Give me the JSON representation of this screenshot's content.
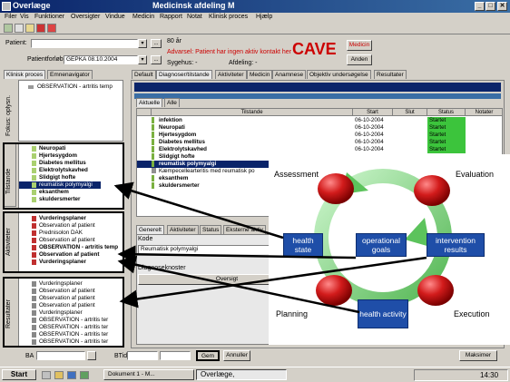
{
  "window": {
    "app_title": "Overlæge",
    "subtitle": "Medicinsk afdeling M",
    "min": "_",
    "max": "□",
    "close": "✕"
  },
  "menu": [
    "Filer",
    "Vis",
    "Funktioner",
    "Oversigter",
    "Vindue",
    "Medicin",
    "Rapport",
    "Notat",
    "Klinisk proces",
    "Hjælp"
  ],
  "header": {
    "patient_label": "Patient:",
    "patient_value": "",
    "age": "80 år",
    "warning": "Advarsel: Patient har ingen aktiv kontakt her",
    "cave": "CAVE",
    "medicin_btn": "Medicin",
    "anden_btn": "Anden",
    "forloeb_label": "Patientforløb:",
    "forloeb_value": "GEPKA 08.10.2004",
    "sygehus": "Sygehus: -",
    "afdeling": "Afdeling: -",
    "dots": "..."
  },
  "left_tabs": [
    "Klinisk proces",
    "Emnenavigator"
  ],
  "left": {
    "fokus_label": "Fokus: oplysn.",
    "fokus_items": [
      "OBSERVATION - artritis temp"
    ],
    "tilstande_label": "Tilstande",
    "tilstande_items": [
      {
        "text": "Neuropati",
        "bold": true
      },
      {
        "text": "Hjertesygdom",
        "bold": true
      },
      {
        "text": "Diabetes mellitus",
        "bold": true
      },
      {
        "text": "Elektrolytskavhed",
        "bold": true
      },
      {
        "text": "Slidgigt hofte",
        "bold": true
      },
      {
        "text": "reumatisk polymyalgi",
        "bold": false,
        "selected": true
      },
      {
        "text": "eksanthem",
        "bold": true
      },
      {
        "text": "skuldersmerter",
        "bold": true
      }
    ],
    "aktiviteter_label": "Aktiviteter",
    "aktiviteter_items": [
      {
        "text": "Vurderingsplaner",
        "bold": true
      },
      {
        "text": "Observation af patient",
        "bold": false
      },
      {
        "text": "Prednisolon DAK",
        "bold": false
      },
      {
        "text": "Observation af patient",
        "bold": false
      },
      {
        "text": "OBSERVATION - artritis temp",
        "bold": true
      },
      {
        "text": "Observation af patient",
        "bold": true
      },
      {
        "text": "Vurderingsplaner",
        "bold": true
      }
    ],
    "resultater_label": "Resultater",
    "resultater_items": [
      "Vurderingsplaner",
      "Observation af patient",
      "Observation af patient",
      "Observation af patient",
      "Vurderingsplaner",
      "OBSERVATION - artritis ter",
      "OBSERVATION - artritis ter",
      "OBSERVATION - artritis ter",
      "OBSERVATION - artritis ter"
    ]
  },
  "main_tabs": [
    "Default",
    "Diagnoser/tilstande",
    "Aktiviteter",
    "Medicin",
    "Anamnese",
    "Objektiv undersøgelse",
    "Resultater"
  ],
  "sub_tabs": [
    "Aktuelle",
    "Alle"
  ],
  "grid": {
    "headers": [
      "Tilstande",
      "Start",
      "Slut",
      "Status",
      "Notater"
    ],
    "rows": [
      {
        "name": "infektion",
        "start": "06-10-2004",
        "status": "Startet"
      },
      {
        "name": "Neuropati",
        "start": "06-10-2004",
        "status": "Startet"
      },
      {
        "name": "Hjertesygdom",
        "start": "06-10-2004",
        "status": "Startet"
      },
      {
        "name": "Diabetes mellitus",
        "start": "06-10-2004",
        "status": "Startet"
      },
      {
        "name": "Elektrolytskavhed",
        "start": "06-10-2004",
        "status": "Startet"
      },
      {
        "name": "Slidgigt hofte",
        "start": "",
        "status": ""
      },
      {
        "name": "reumatisk polymyalgi",
        "start": "",
        "status": "",
        "selected": true
      },
      {
        "name": "Kæmpecellearteritis med reumatisk po",
        "start": "",
        "status": ""
      },
      {
        "name": "eksanthem",
        "start": "",
        "status": ""
      },
      {
        "name": "skuldersmerter",
        "start": "",
        "status": ""
      }
    ]
  },
  "lower_tabs": [
    "Generelt",
    "Aktiviteter",
    "Status",
    "Eksterne aktiv"
  ],
  "lower": {
    "kode_label": "Kode",
    "kode_value": "Reumatisk polymyalgi",
    "diag_label": "Diagnoseknoster",
    "oversigt": "Oversigt"
  },
  "bottom": {
    "ba_label": "BA",
    "btid_label": "BTid",
    "gem": "Gem",
    "annuller": "Annuller",
    "maksimer": "Maksimer"
  },
  "taskbar": {
    "start": "Start",
    "task1": "Dokument 1 - M...",
    "task2": "Overlæge,",
    "clock": "14:30"
  },
  "overlay": {
    "assessment": "Assessment",
    "evaluation": "Evaluation",
    "planning": "Planning",
    "execution": "Execution",
    "health_state": "health state",
    "operational_goals": "operational goals",
    "intervention_results": "intervention results",
    "health_activity": "health activity"
  },
  "colors": {
    "titlebar": "#0a246a",
    "cave": "#cc0000",
    "status_green": "#3cc43c",
    "box_blue": "#1f4ea8",
    "sphere_red": "#c81616",
    "ring_green": "#6fd36f"
  }
}
